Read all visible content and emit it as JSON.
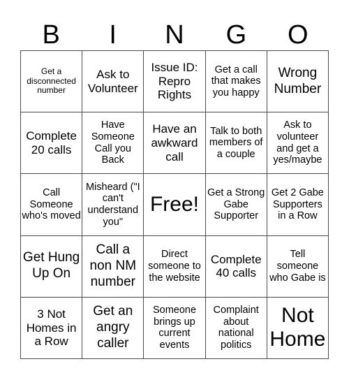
{
  "header": {
    "letters": [
      "B",
      "I",
      "N",
      "G",
      "O"
    ]
  },
  "board": {
    "rows": [
      [
        "Get a disconnected number",
        "Ask to Volunteer",
        "Issue ID: Repro Rights",
        "Get a call that makes you happy",
        "Wrong Number"
      ],
      [
        "Complete 20 calls",
        "Have Someone Call you Back",
        "Have an awkward call",
        "Talk to both members of a couple",
        "Ask to volunteer and get a yes/maybe"
      ],
      [
        "Call Someone who's moved",
        "Misheard (\"I can't understand you\"",
        "Free!",
        "Get a Strong Gabe Supporter",
        "Get 2 Gabe Supporters in a Row"
      ],
      [
        "Get Hung Up On",
        "Call a non NM number",
        "Direct someone to the website",
        "Complete 40 calls",
        "Tell someone who Gabe is"
      ],
      [
        "3 Not Homes in a Row",
        "Get an angry caller",
        "Someone brings up current events",
        "Complaint about national politics",
        "Not Home"
      ]
    ]
  }
}
